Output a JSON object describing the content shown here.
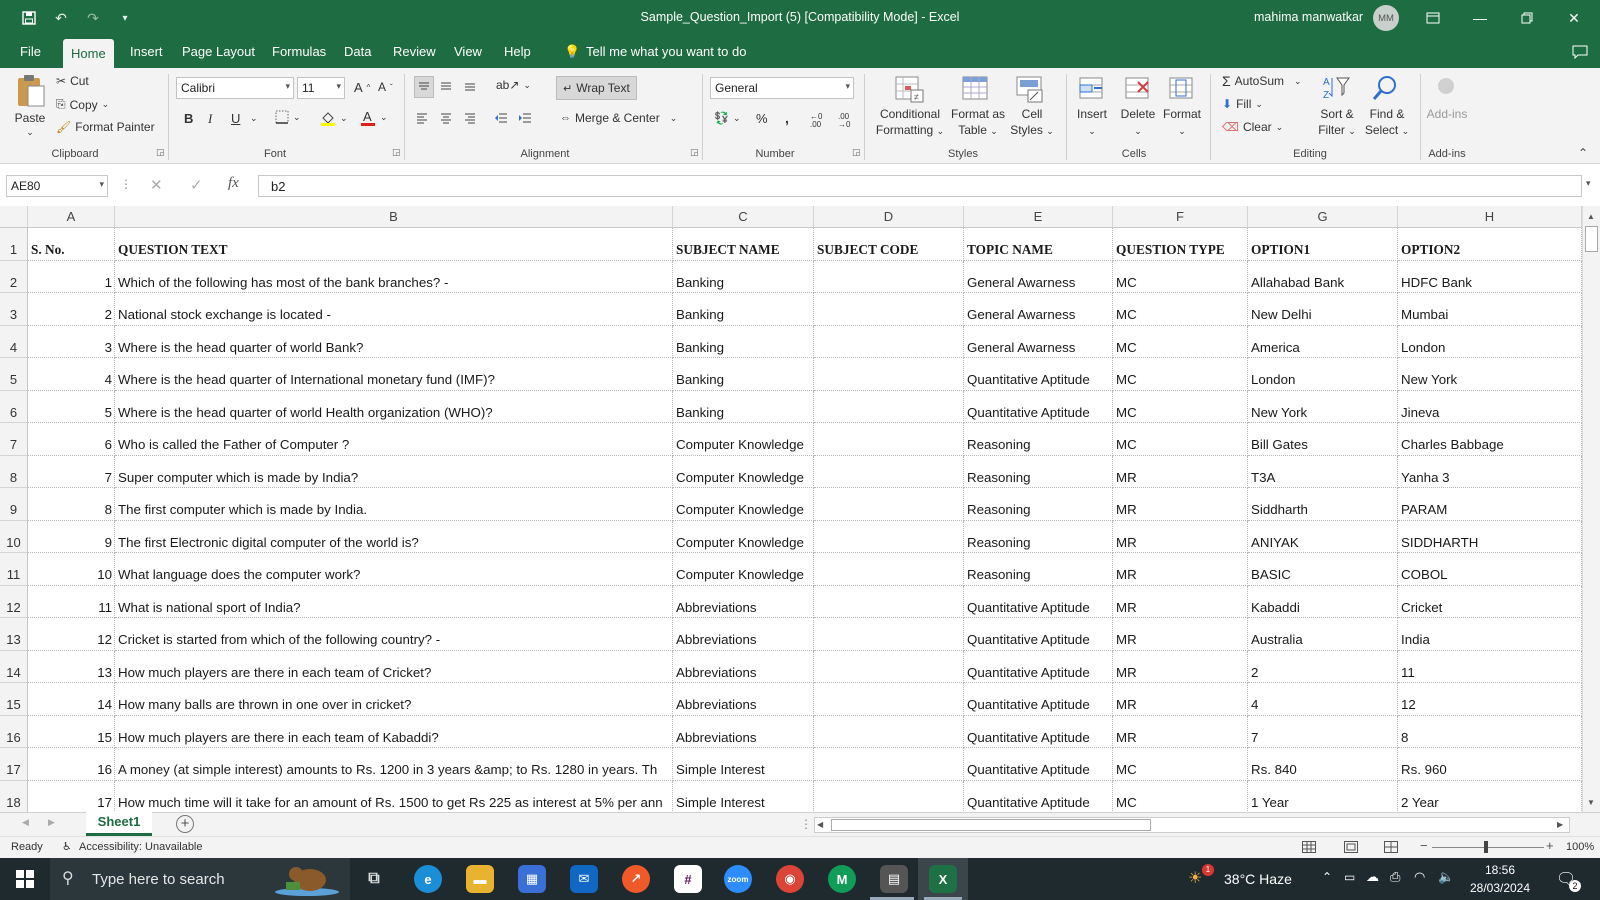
{
  "titlebar": {
    "title": "Sample_Question_Import (5)  [Compatibility Mode]  -  Excel",
    "user": "mahima manwatkar",
    "avatar_initials": "MM"
  },
  "menu": {
    "tabs": [
      "File",
      "Home",
      "Insert",
      "Page Layout",
      "Formulas",
      "Data",
      "Review",
      "View",
      "Help"
    ],
    "active": "Home",
    "tell_me": "Tell me what you want to do"
  },
  "ribbon": {
    "clipboard": {
      "paste": "Paste",
      "cut": "Cut",
      "copy": "Copy",
      "format_painter": "Format Painter",
      "label": "Clipboard"
    },
    "font": {
      "name": "Calibri",
      "size": "11",
      "label": "Font",
      "bold": "B",
      "italic": "I",
      "underline": "U"
    },
    "alignment": {
      "wrap_text": "Wrap Text",
      "merge_center": "Merge & Center",
      "label": "Alignment"
    },
    "number": {
      "format": "General",
      "label": "Number",
      "percent": "%",
      "comma": ","
    },
    "styles": {
      "conditional": "Conditional",
      "conditional2": "Formatting",
      "format_as": "Format as",
      "format_as2": "Table",
      "cell": "Cell",
      "cell2": "Styles",
      "label": "Styles"
    },
    "cells": {
      "insert": "Insert",
      "delete": "Delete",
      "format": "Format",
      "label": "Cells"
    },
    "editing": {
      "autosum": "AutoSum",
      "fill": "Fill",
      "clear": "Clear",
      "sort": "Sort &",
      "sort2": "Filter",
      "find": "Find &",
      "find2": "Select",
      "label": "Editing"
    },
    "addins": {
      "addins": "Add-ins",
      "label": "Add-ins"
    }
  },
  "formula_bar": {
    "name_box": "AE80",
    "fx": "fx",
    "value": "b2"
  },
  "columns": [
    "A",
    "B",
    "C",
    "D",
    "E",
    "F",
    "G",
    "H"
  ],
  "header_row": [
    "S. No.",
    "QUESTION TEXT",
    "SUBJECT NAME",
    "SUBJECT CODE",
    "TOPIC NAME",
    "QUESTION TYPE",
    "OPTION1",
    "OPTION2"
  ],
  "rows": [
    [
      "1",
      "Which of the following has most of the bank branches? -",
      "Banking",
      "",
      "General Awarness",
      "MC",
      "Allahabad Bank",
      "HDFC Bank"
    ],
    [
      "2",
      "National stock exchange is located -",
      "Banking",
      "",
      "General Awarness",
      "MC",
      "New Delhi",
      "Mumbai"
    ],
    [
      "3",
      "Where is the head quarter of world Bank?",
      "Banking",
      "",
      "General Awarness",
      "MC",
      "America",
      "London"
    ],
    [
      "4",
      "Where is the head quarter of International monetary fund (IMF)?",
      "Banking",
      "",
      "Quantitative Aptitude",
      "MC",
      "London",
      "New York"
    ],
    [
      "5",
      "Where is the head quarter of world Health organization (WHO)?",
      "Banking",
      "",
      "Quantitative Aptitude",
      "MC",
      "New York",
      "Jineva"
    ],
    [
      "6",
      "Who is called the Father of Computer ?",
      "Computer Knowledge",
      "",
      "Reasoning",
      "MC",
      "Bill Gates",
      "Charles Babbage"
    ],
    [
      "7",
      "Super computer which is made by India?",
      "Computer Knowledge",
      "",
      "Reasoning",
      "MR",
      "T3A",
      "Yanha 3"
    ],
    [
      "8",
      "The first computer which is made by India.",
      "Computer Knowledge",
      "",
      "Reasoning",
      "MR",
      "Siddharth",
      "PARAM"
    ],
    [
      "9",
      "The first Electronic digital computer of the world is?",
      "Computer Knowledge",
      "",
      "Reasoning",
      "MR",
      "ANIYAK",
      "SIDDHARTH"
    ],
    [
      "10",
      "What language does the computer work?",
      "Computer Knowledge",
      "",
      "Reasoning",
      "MR",
      "BASIC",
      "COBOL"
    ],
    [
      "11",
      "What is national sport of India?",
      "Abbreviations",
      "",
      "Quantitative Aptitude",
      "MR",
      "Kabaddi",
      "Cricket"
    ],
    [
      "12",
      "Cricket is started from which of the following country? -",
      "Abbreviations",
      "",
      "Quantitative Aptitude",
      "MR",
      "Australia",
      "India"
    ],
    [
      "13",
      "How much players are there in each team of Cricket?",
      "Abbreviations",
      "",
      "Quantitative Aptitude",
      "MR",
      "2",
      "11"
    ],
    [
      "14",
      "How many balls are thrown in one over in cricket?",
      "Abbreviations",
      "",
      "Quantitative Aptitude",
      "MR",
      "4",
      "12"
    ],
    [
      "15",
      "How much players are there in each team of Kabaddi?",
      "Abbreviations",
      "",
      "Quantitative Aptitude",
      "MR",
      "7",
      "8"
    ],
    [
      "16",
      "A money (at simple interest) amounts to Rs. 1200 in 3 years &amp; to Rs. 1280 in years. Th",
      "Simple Interest",
      "",
      "Quantitative Aptitude",
      "MC",
      "Rs. 840",
      "Rs. 960"
    ],
    [
      "17",
      "How much time will it take for an amount of Rs. 1500 to get Rs 225 as interest at 5% per ann",
      "Simple Interest",
      "",
      "Quantitative Aptitude",
      "MC",
      "1 Year",
      "2 Year"
    ]
  ],
  "sheet": {
    "name": "Sheet1"
  },
  "status": {
    "ready": "Ready",
    "accessibility": "Accessibility: Unavailable",
    "zoom": "100%"
  },
  "taskbar": {
    "search": "Type here to search",
    "weather": "38°C  Haze",
    "time": "18:56",
    "date": "28/03/2024",
    "notif": "2",
    "weather_badge": "1"
  }
}
